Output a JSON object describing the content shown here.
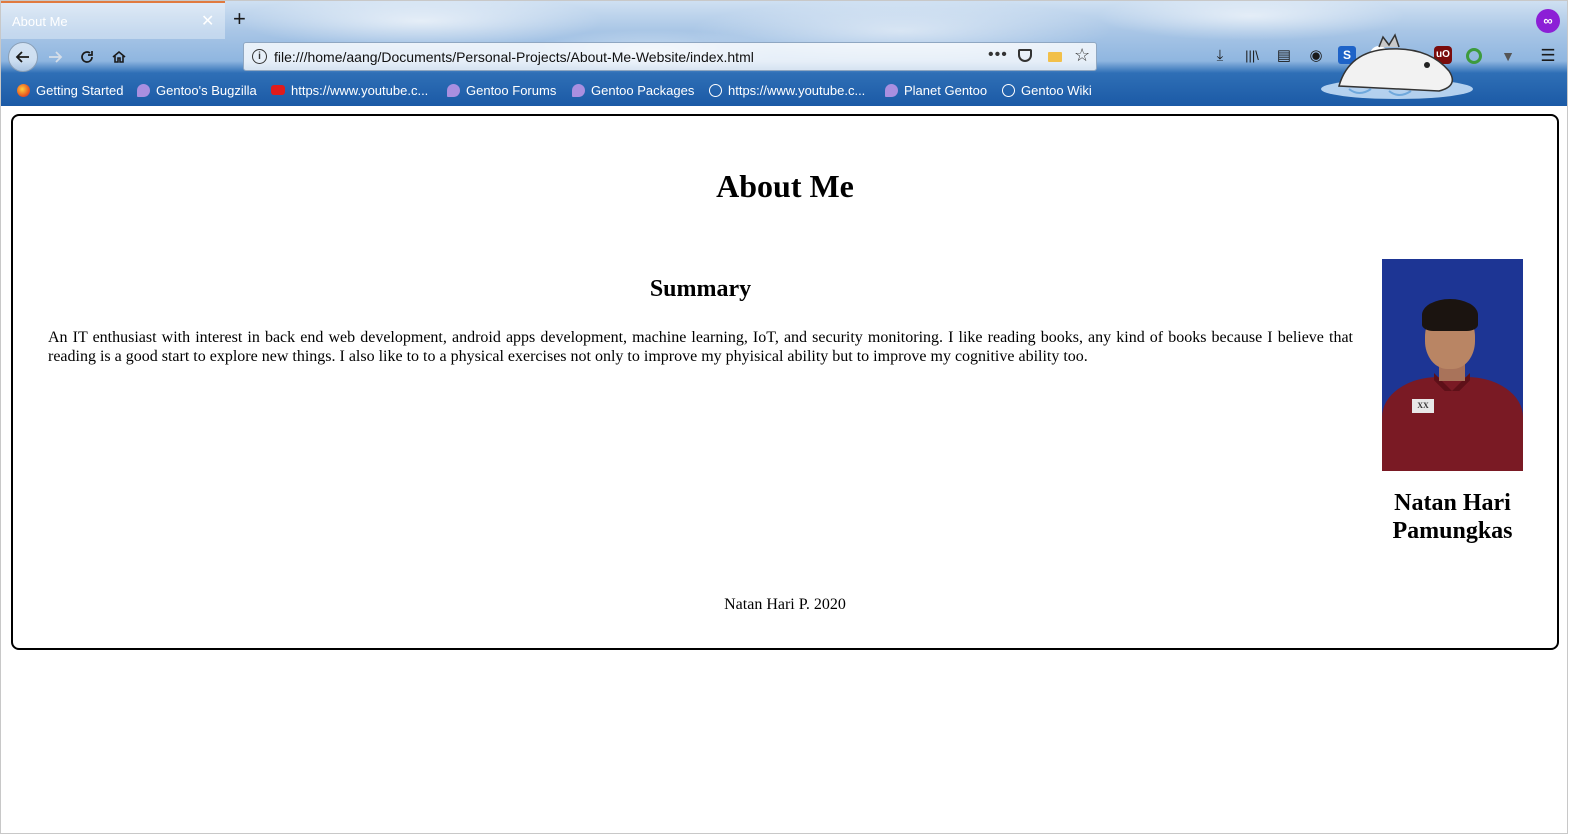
{
  "browser": {
    "tab_title": "About Me",
    "tab_close": "✕",
    "new_tab": "+",
    "url": "file:///home/aang/Documents/Personal-Projects/About-Me-Website/index.html",
    "url_more": "•••",
    "icons": [
      "back-icon",
      "forward-icon",
      "reload-icon",
      "home-icon",
      "info-icon",
      "more-icon",
      "pocket-icon",
      "folder-icon",
      "star-icon",
      "download-icon",
      "library-icon",
      "sidebar-icon",
      "account-icon",
      "s-extension-icon",
      "skype-icon",
      "ublock-icon",
      "green-extension-icon",
      "v-extension-icon",
      "menu-icon",
      "private-browsing-icon"
    ]
  },
  "bookmarks": [
    {
      "label": "Getting Started",
      "icon": "firefox-icon"
    },
    {
      "label": "Gentoo's Bugzilla",
      "icon": "gentoo-icon"
    },
    {
      "label": "https://www.youtube.c...",
      "icon": "youtube-icon"
    },
    {
      "label": "Gentoo Forums",
      "icon": "gentoo-icon"
    },
    {
      "label": "Gentoo Packages",
      "icon": "gentoo-icon"
    },
    {
      "label": "https://www.youtube.c...",
      "icon": "globe-icon"
    },
    {
      "label": "Planet Gentoo",
      "icon": "gentoo-icon"
    },
    {
      "label": "Gentoo Wiki",
      "icon": "globe-icon"
    }
  ],
  "page": {
    "title": "About Me",
    "summary_title": "Summary",
    "summary_text": "An IT enthusiast with interest in back end web development, android apps development, machine learning, IoT, and security monitoring. I like reading books, any kind of books because I believe that reading is a good start to explore new things. I also like to to a physical exercises not only to improve my phyisical ability but to improve my cognitive ability too.",
    "name_line1": "Natan Hari",
    "name_line2": "Pamungkas",
    "footer": "Natan Hari P. 2020"
  },
  "colors": {
    "tab_accent": "#e07a3f",
    "photo_background": "#1d3594",
    "private_icon": "#8c1fd6"
  }
}
